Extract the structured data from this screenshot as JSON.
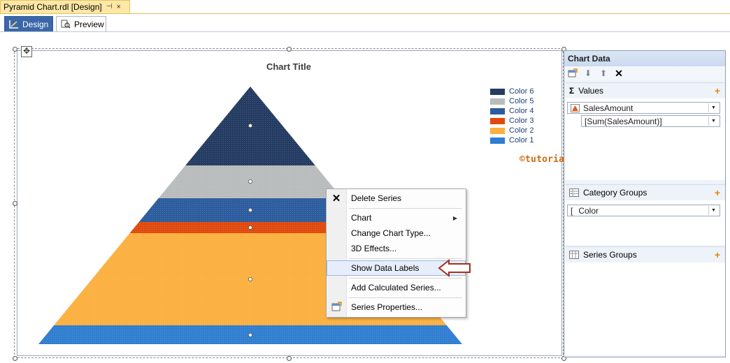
{
  "document_tab": {
    "title": "Pyramid Chart.rdl [Design]",
    "pin_glyph": "⊣",
    "close_glyph": "×"
  },
  "view_tabs": {
    "design": "Design",
    "preview": "Preview"
  },
  "chart": {
    "title": "Chart Title",
    "legend": [
      {
        "label": "Color 6",
        "color": "#243b62"
      },
      {
        "label": "Color 5",
        "color": "#b8bcbd"
      },
      {
        "label": "Color 4",
        "color": "#2c5c9e"
      },
      {
        "label": "Color 3",
        "color": "#e04a0f"
      },
      {
        "label": "Color 2",
        "color": "#fbb040"
      },
      {
        "label": "Color 1",
        "color": "#2f7ed0"
      }
    ]
  },
  "watermark": "©tutorialgateway.org",
  "context_menu": {
    "delete_series": "Delete Series",
    "chart": "Chart",
    "change_chart_type": "Change Chart Type...",
    "three_d_effects": "3D Effects...",
    "show_data_labels": "Show Data Labels",
    "add_calculated_series": "Add Calculated Series...",
    "series_properties": "Series Properties..."
  },
  "chart_data_panel": {
    "title": "Chart Data",
    "values": {
      "heading": "Values",
      "field": "SalesAmount",
      "aggregate": "[Sum(SalesAmount)]"
    },
    "category_groups": {
      "heading": "Category Groups",
      "field": "Color"
    },
    "series_groups": {
      "heading": "Series Groups"
    }
  }
}
